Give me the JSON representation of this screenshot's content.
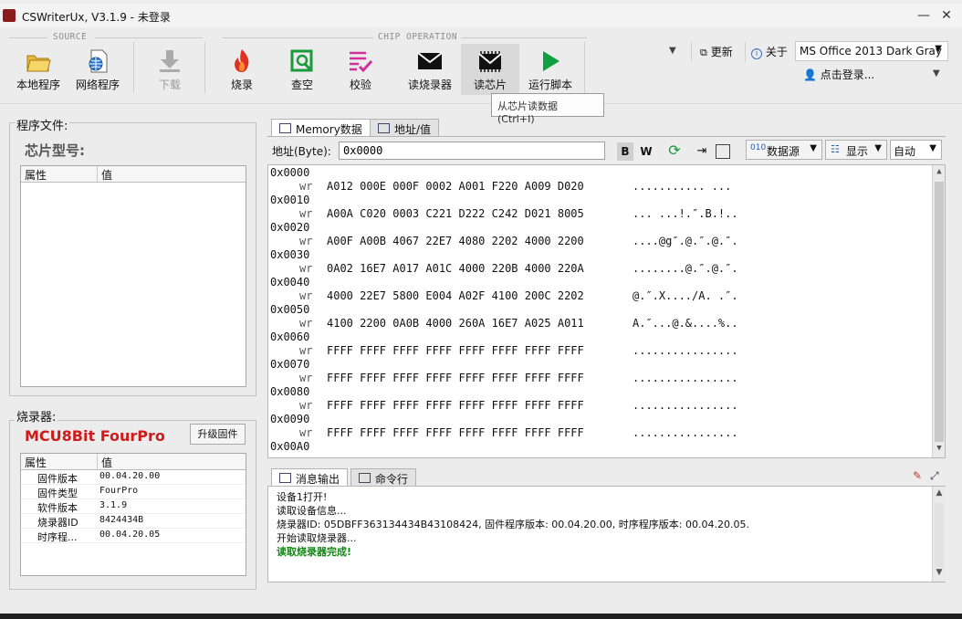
{
  "window": {
    "title": "CSWriterUx, V3.1.9 - 未登录",
    "minimize": "—",
    "close": "✕"
  },
  "ribbon": {
    "source_caption": "SOURCE",
    "chip_caption": "CHIP OPERATION",
    "buttons": {
      "local": "本地程序",
      "network": "网络程序",
      "download": "下载",
      "burn": "烧录",
      "blank": "查空",
      "verify": "校验",
      "read_prog": "读烧录器",
      "read_chip": "读芯片",
      "script": "运行脚本"
    },
    "update": "更新",
    "about": "关于",
    "theme": "MS Office 2013 Dark Gray",
    "login": "点击登录..."
  },
  "tooltip": "从芯片读数据 (Ctrl+I)",
  "program_panel": {
    "title": "程序文件:",
    "chip_model": "芯片型号:",
    "col_attr": "属性",
    "col_value": "值"
  },
  "programmer_panel": {
    "title": "烧录器:",
    "name": "MCU8Bit FourPro",
    "upgrade": "升级固件",
    "col_attr": "属性",
    "col_value": "值",
    "rows": [
      {
        "k": "固件版本",
        "v": "00.04.20.00"
      },
      {
        "k": "固件类型",
        "v": "FourPro"
      },
      {
        "k": "软件版本",
        "v": "3.1.9"
      },
      {
        "k": "烧录器ID",
        "v": "8424434B"
      },
      {
        "k": "时序程...",
        "v": "00.04.20.05"
      }
    ]
  },
  "tabs": {
    "memory": "Memory数据",
    "addr_value": "地址/值",
    "messages": "消息输出",
    "cmdline": "命令行"
  },
  "addrbar": {
    "label": "地址(Byte):",
    "value": "0x0000",
    "bold": "B",
    "word": "W",
    "datasource": "数据源",
    "display": "显示",
    "auto": "自动"
  },
  "hex_rows": [
    {
      "addr": "0x0000",
      "wr": "wr",
      "words": "A012 000E 000F 0002  A001 F220 A009 D020",
      "ascii": "........... ..."
    },
    {
      "addr": "0x0010",
      "wr": "wr",
      "words": "A00A C020 0003 C221  D222 C242 D021 8005",
      "ascii": "... ...!.″.B.!.."
    },
    {
      "addr": "0x0020",
      "wr": "wr",
      "words": "A00F A00B 4067 22E7  4080 2202 4000 2200",
      "ascii": "....@g″.@.″.@.″."
    },
    {
      "addr": "0x0030",
      "wr": "wr",
      "words": "0A02 16E7 A017 A01C  4000 220B 4000 220A",
      "ascii": "........@.″.@.″."
    },
    {
      "addr": "0x0040",
      "wr": "wr",
      "words": "4000 22E7 5800 E004  A02F 4100 200C 2202",
      "ascii": "@.″.X..../A. .″."
    },
    {
      "addr": "0x0050",
      "wr": "wr",
      "words": "4100 2200 0A0B 4000  260A 16E7 A025 A011",
      "ascii": "A.″...@.&....%.."
    },
    {
      "addr": "0x0060",
      "wr": "wr",
      "words": "FFFF FFFF FFFF FFFF  FFFF FFFF FFFF FFFF",
      "ascii": "................"
    },
    {
      "addr": "0x0070",
      "wr": "wr",
      "words": "FFFF FFFF FFFF FFFF  FFFF FFFF FFFF FFFF",
      "ascii": "................"
    },
    {
      "addr": "0x0080",
      "wr": "wr",
      "words": "FFFF FFFF FFFF FFFF  FFFF FFFF FFFF FFFF",
      "ascii": "................"
    },
    {
      "addr": "0x0090",
      "wr": "wr",
      "words": "FFFF FFFF FFFF FFFF  FFFF FFFF FFFF FFFF",
      "ascii": "................"
    },
    {
      "addr": "0x00A0",
      "wr": "",
      "words": "",
      "ascii": ""
    }
  ],
  "log": [
    "设备1打开!",
    "读取设备信息...",
    "烧录器ID: 05DBFF363134434B43108424, 固件程序版本: 00.04.20.00, 时序程序版本: 00.04.20.05.",
    "开始读取烧录器...",
    "读取烧录器完成!"
  ]
}
